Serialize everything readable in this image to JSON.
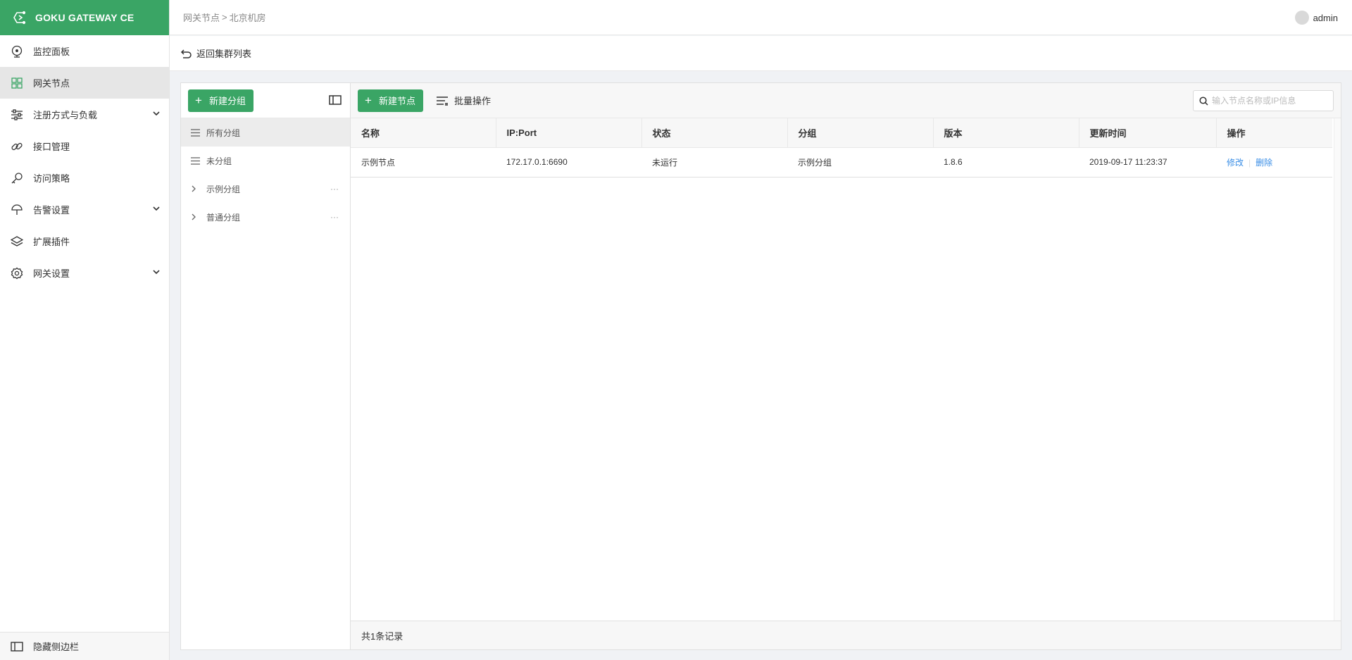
{
  "brand": {
    "name": "GOKU GATEWAY CE",
    "color": "#3aa565"
  },
  "sidebar": {
    "items": [
      {
        "label": "监控面板",
        "icon": "monitor-icon",
        "expandable": false
      },
      {
        "label": "网关节点",
        "icon": "grid-icon",
        "expandable": false,
        "active": true
      },
      {
        "label": "注册方式与负载",
        "icon": "sliders-icon",
        "expandable": true
      },
      {
        "label": "接口管理",
        "icon": "link-icon",
        "expandable": false
      },
      {
        "label": "访问策略",
        "icon": "key-icon",
        "expandable": false
      },
      {
        "label": "告警设置",
        "icon": "bell-icon",
        "expandable": true
      },
      {
        "label": "扩展插件",
        "icon": "layers-icon",
        "expandable": false
      },
      {
        "label": "网关设置",
        "icon": "gear-icon",
        "expandable": true
      }
    ],
    "footer_label": "隐藏侧边栏"
  },
  "header": {
    "breadcrumb": [
      "网关节点",
      "北京机房"
    ],
    "breadcrumb_sep": ">",
    "user": "admin"
  },
  "backbar": {
    "label": "返回集群列表"
  },
  "groups": {
    "new_button": "新建分组",
    "items": [
      {
        "label": "所有分组",
        "type": "list",
        "active": true
      },
      {
        "label": "未分组",
        "type": "list"
      },
      {
        "label": "示例分组",
        "type": "tree",
        "has_more": true
      },
      {
        "label": "普通分组",
        "type": "tree",
        "has_more": true
      }
    ],
    "more_glyph": "···"
  },
  "toolbar": {
    "new_node_button": "新建节点",
    "batch_label": "批量操作",
    "search_placeholder": "输入节点名称或IP信息"
  },
  "table": {
    "columns": [
      "名称",
      "IP:Port",
      "状态",
      "分组",
      "版本",
      "更新时间",
      "操作"
    ],
    "rows": [
      {
        "name": "示例节点",
        "ip_port": "172.17.0.1:6690",
        "status": "未运行",
        "group": "示例分组",
        "version": "1.8.6",
        "updated": "2019-09-17 11:23:37",
        "edit": "修改",
        "delete": "删除"
      }
    ]
  },
  "footer": {
    "total": "共1条记录"
  },
  "colors": {
    "status_off": "#e6a23c",
    "link": "#3a8ee6"
  }
}
